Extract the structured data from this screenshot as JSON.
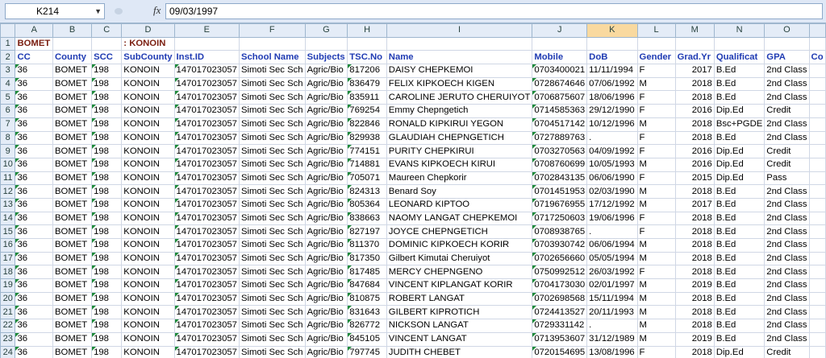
{
  "formula_bar": {
    "name_box": "K214",
    "fx_label": "fx",
    "formula": "09/03/1997"
  },
  "columns": [
    "A",
    "B",
    "C",
    "D",
    "E",
    "F",
    "G",
    "H",
    "I",
    "J",
    "K",
    "L",
    "M",
    "N",
    "O",
    ""
  ],
  "selected_column": "K",
  "row1": {
    "number": "1",
    "a": "BOMET",
    "d": ": KONOIN"
  },
  "headers": [
    "CC",
    "County",
    "SCC",
    "SubCounty",
    "Inst.ID",
    "School Name",
    "Subjects",
    "TSC.No",
    "Name",
    "Mobile",
    "DoB",
    "Gender",
    "Grad.Yr",
    "Qualificat",
    "GPA",
    "Co"
  ],
  "rows": [
    [
      "3",
      "36",
      "BOMET",
      "198",
      "KONOIN",
      "147017023057",
      "Simoti Sec Sch",
      "Agric/Bio",
      "817206",
      "DAISY  CHEPKEMOI",
      "0703400021",
      "11/11/1994",
      "F",
      "2017",
      "B.Ed",
      "2nd Class"
    ],
    [
      "4",
      "36",
      "BOMET",
      "198",
      "KONOIN",
      "147017023057",
      "Simoti Sec Sch",
      "Agric/Bio",
      "836479",
      "FELIX KIPKOECH KIGEN",
      "0728674646",
      "07/06/1992",
      "M",
      "2018",
      "B.Ed",
      "2nd Class"
    ],
    [
      "5",
      "36",
      "BOMET",
      "198",
      "KONOIN",
      "147017023057",
      "Simoti Sec Sch",
      "Agric/Bio",
      "835911",
      "CAROLINE JERUTO CHERUIYOT",
      "0706875607",
      "18/06/1996",
      "F",
      "2018",
      "B.Ed",
      "2nd Class"
    ],
    [
      "6",
      "36",
      "BOMET",
      "198",
      "KONOIN",
      "147017023057",
      "Simoti Sec Sch",
      "Agric/Bio",
      "769254",
      "Emmy  Chepngetich",
      "0714585363",
      "29/12/1990",
      "F",
      "2016",
      "Dip.Ed",
      "Credit"
    ],
    [
      "7",
      "36",
      "BOMET",
      "198",
      "KONOIN",
      "147017023057",
      "Simoti Sec Sch",
      "Agric/Bio",
      "822846",
      "RONALD KIPKIRUI YEGON",
      "0704517142",
      "10/12/1996",
      "M",
      "2018",
      "Bsc+PGDE",
      "2nd Class"
    ],
    [
      "8",
      "36",
      "BOMET",
      "198",
      "KONOIN",
      "147017023057",
      "Simoti Sec Sch",
      "Agric/Bio",
      "829938",
      "GLAUDIAH  CHEPNGETICH",
      "0727889763",
      ".",
      "F",
      "2018",
      "B.Ed",
      "2nd Class"
    ],
    [
      "9",
      "36",
      "BOMET",
      "198",
      "KONOIN",
      "147017023057",
      "Simoti Sec Sch",
      "Agric/Bio",
      "774151",
      "PURITY  CHEPKIRUI",
      "0703270563",
      "04/09/1992",
      "F",
      "2016",
      "Dip.Ed",
      "Credit"
    ],
    [
      "10",
      "36",
      "BOMET",
      "198",
      "KONOIN",
      "147017023057",
      "Simoti Sec Sch",
      "Agric/Bio",
      "714881",
      "EVANS KIPKOECH KIRUI",
      "0708760699",
      "10/05/1993",
      "M",
      "2016",
      "Dip.Ed",
      "Credit"
    ],
    [
      "11",
      "36",
      "BOMET",
      "198",
      "KONOIN",
      "147017023057",
      "Simoti Sec Sch",
      "Agric/Bio",
      "705071",
      "Maureen  Chepkorir",
      "0702843135",
      "06/06/1990",
      "F",
      "2015",
      "Dip.Ed",
      "Pass"
    ],
    [
      "12",
      "36",
      "BOMET",
      "198",
      "KONOIN",
      "147017023057",
      "Simoti Sec Sch",
      "Agric/Bio",
      "824313",
      "Benard  Soy",
      "0701451953",
      "02/03/1990",
      "M",
      "2018",
      "B.Ed",
      "2nd Class"
    ],
    [
      "13",
      "36",
      "BOMET",
      "198",
      "KONOIN",
      "147017023057",
      "Simoti Sec Sch",
      "Agric/Bio",
      "805364",
      "LEONARD  KIPTOO",
      "0719676955",
      "17/12/1992",
      "M",
      "2017",
      "B.Ed",
      "2nd Class"
    ],
    [
      "14",
      "36",
      "BOMET",
      "198",
      "KONOIN",
      "147017023057",
      "Simoti Sec Sch",
      "Agric/Bio",
      "838663",
      "NAOMY LANGAT CHEPKEMOI",
      "0717250603",
      "19/06/1996",
      "F",
      "2018",
      "B.Ed",
      "2nd Class"
    ],
    [
      "15",
      "36",
      "BOMET",
      "198",
      "KONOIN",
      "147017023057",
      "Simoti Sec Sch",
      "Agric/Bio",
      "827197",
      "JOYCE  CHEPNGETICH",
      "0708938765",
      ".",
      "F",
      "2018",
      "B.Ed",
      "2nd Class"
    ],
    [
      "16",
      "36",
      "BOMET",
      "198",
      "KONOIN",
      "147017023057",
      "Simoti Sec Sch",
      "Agric/Bio",
      "811370",
      "DOMINIC KIPKOECH KORIR",
      "0703930742",
      "06/06/1994",
      "M",
      "2018",
      "B.Ed",
      "2nd Class"
    ],
    [
      "17",
      "36",
      "BOMET",
      "198",
      "KONOIN",
      "147017023057",
      "Simoti Sec Sch",
      "Agric/Bio",
      "817350",
      "Gilbert Kimutai Cheruiyot",
      "0702656660",
      "05/05/1994",
      "M",
      "2018",
      "B.Ed",
      "2nd Class"
    ],
    [
      "18",
      "36",
      "BOMET",
      "198",
      "KONOIN",
      "147017023057",
      "Simoti Sec Sch",
      "Agric/Bio",
      "817485",
      "MERCY  CHEPNGENO",
      "0750992512",
      "26/03/1992",
      "F",
      "2018",
      "B.Ed",
      "2nd Class"
    ],
    [
      "19",
      "36",
      "BOMET",
      "198",
      "KONOIN",
      "147017023057",
      "Simoti Sec Sch",
      "Agric/Bio",
      "847684",
      "VINCENT KIPLANGAT KORIR",
      "0704173030",
      "02/01/1997",
      "M",
      "2019",
      "B.Ed",
      "2nd Class"
    ],
    [
      "20",
      "36",
      "BOMET",
      "198",
      "KONOIN",
      "147017023057",
      "Simoti Sec Sch",
      "Agric/Bio",
      "810875",
      "ROBERT  LANGAT",
      "0702698568",
      "15/11/1994",
      "M",
      "2018",
      "B.Ed",
      "2nd Class"
    ],
    [
      "21",
      "36",
      "BOMET",
      "198",
      "KONOIN",
      "147017023057",
      "Simoti Sec Sch",
      "Agric/Bio",
      "831643",
      "GILBERT  KIPROTICH",
      "0724413527",
      "20/11/1993",
      "M",
      "2018",
      "B.Ed",
      "2nd Class"
    ],
    [
      "22",
      "36",
      "BOMET",
      "198",
      "KONOIN",
      "147017023057",
      "Simoti Sec Sch",
      "Agric/Bio",
      "826772",
      "NICKSON  LANGAT",
      "0729331142",
      ".",
      "M",
      "2018",
      "B.Ed",
      "2nd Class"
    ],
    [
      "23",
      "36",
      "BOMET",
      "198",
      "KONOIN",
      "147017023057",
      "Simoti Sec Sch",
      "Agric/Bio",
      "845105",
      "VINCENT  LANGAT",
      "0713953607",
      "31/12/1989",
      "M",
      "2019",
      "B.Ed",
      "2nd Class"
    ],
    [
      "24",
      "36",
      "BOMET",
      "198",
      "KONOIN",
      "147017023057",
      "Simoti Sec Sch",
      "Agric/Bio",
      "797745",
      "JUDITH  CHEBET",
      "0720154695",
      "13/08/1996",
      "F",
      "2018",
      "Dip.Ed",
      "Credit"
    ]
  ]
}
